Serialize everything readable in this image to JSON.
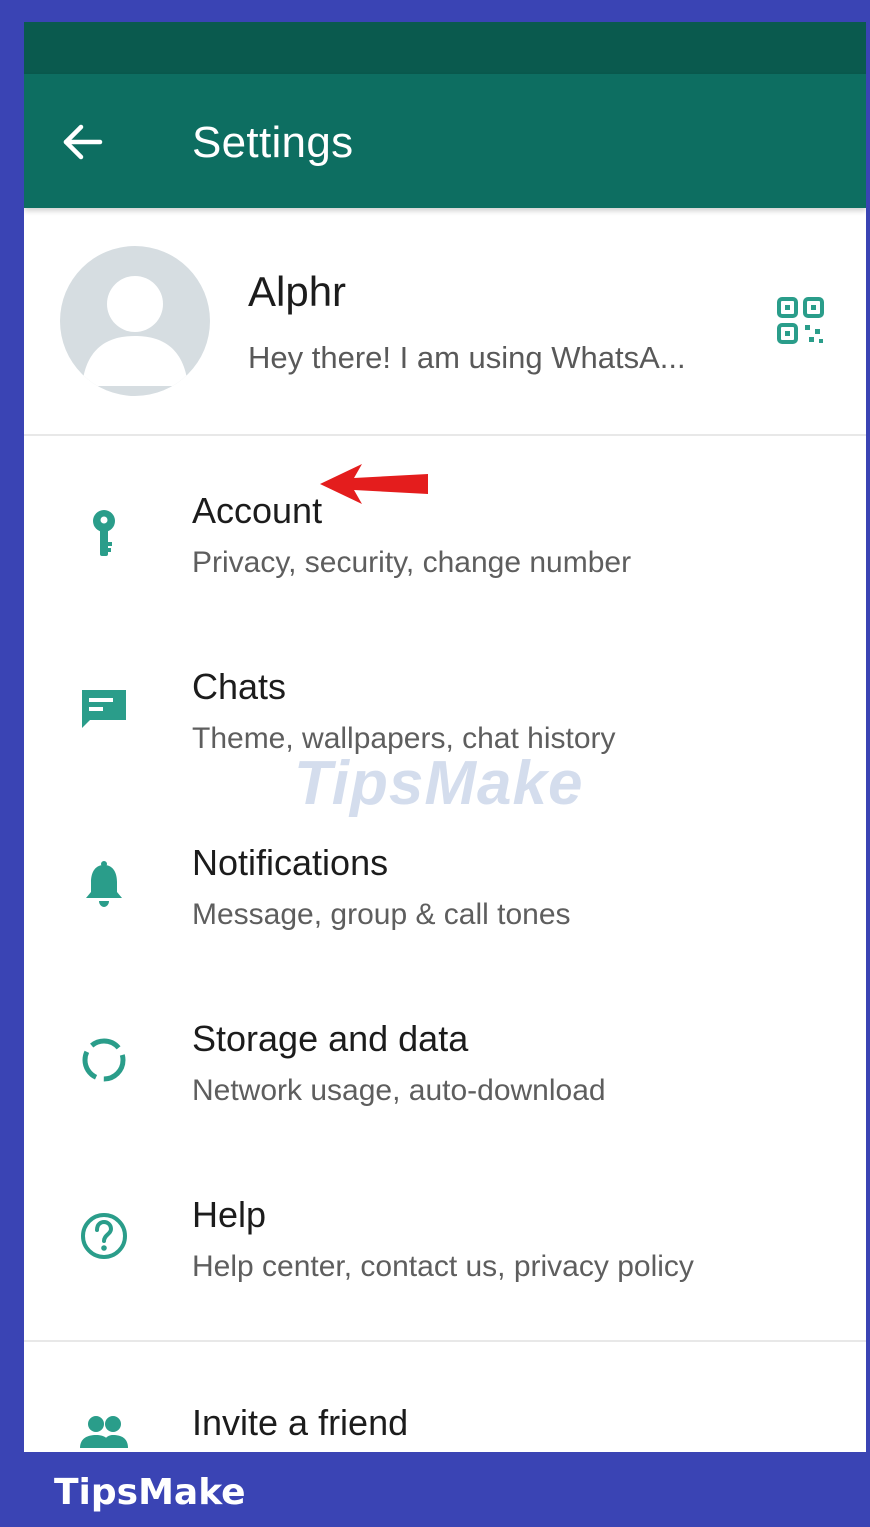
{
  "header": {
    "title": "Settings",
    "back_icon": "arrow-left-icon"
  },
  "profile": {
    "name": "Alphr",
    "status": "Hey there! I am using WhatsA...",
    "qr_icon": "qr-code-icon"
  },
  "menu": [
    {
      "id": "account",
      "title": "Account",
      "subtitle": "Privacy, security, change number",
      "icon": "key-icon"
    },
    {
      "id": "chats",
      "title": "Chats",
      "subtitle": "Theme, wallpapers, chat history",
      "icon": "chat-icon"
    },
    {
      "id": "notifications",
      "title": "Notifications",
      "subtitle": "Message, group & call tones",
      "icon": "bell-icon"
    },
    {
      "id": "storage",
      "title": "Storage and data",
      "subtitle": "Network usage, auto-download",
      "icon": "storage-icon"
    },
    {
      "id": "help",
      "title": "Help",
      "subtitle": "Help center, contact us, privacy policy",
      "icon": "help-icon"
    }
  ],
  "invite": {
    "title": "Invite a friend",
    "icon": "people-icon"
  },
  "watermark": "TipsMake",
  "brand": "TipsMake",
  "colors": {
    "appbar": "#0d6e61",
    "statusbar": "#0a5a4e",
    "icon_teal": "#2a9d8a",
    "frame": "#3a44b4",
    "annotation_arrow": "#e41d1d"
  }
}
